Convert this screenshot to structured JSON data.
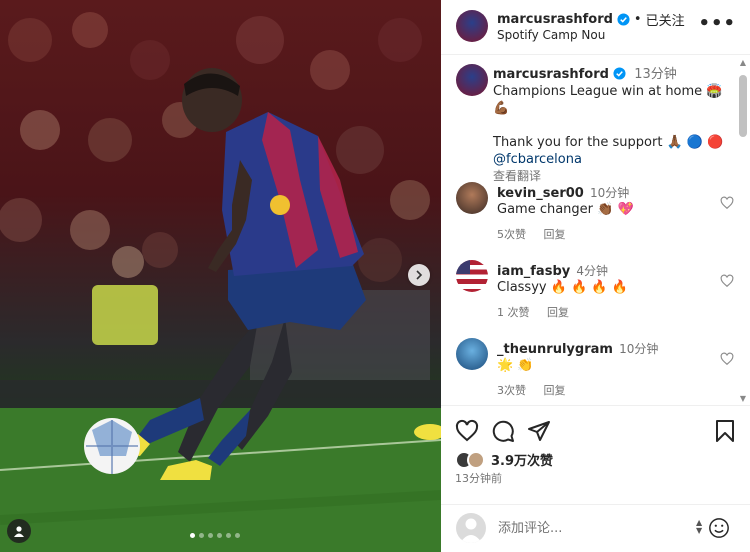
{
  "post": {
    "author": "marcusrashford",
    "follow_status": "已关注",
    "location": "Spotify Camp Nou",
    "more_icon": "more-options-icon",
    "caption_time": "13分钟",
    "caption_line1": "Champions League win at home 🏟️",
    "caption_line2": "💪🏾",
    "caption_line3": "Thank you for the support 🙏🏾 🔵 🔴",
    "caption_mention": "@fcbarcelona",
    "see_translation": "查看翻译",
    "photo_index": 1,
    "photo_count": 6
  },
  "comments": [
    {
      "user": "kevin_ser00",
      "time": "10分钟",
      "text": "Game changer 👏🏾 💖",
      "likes": "5次赞",
      "reply": "回复",
      "avatar_color": "#8a6a4a"
    },
    {
      "user": "iam_fasby",
      "time": "4分钟",
      "text": "Classyy 🔥 🔥 🔥 🔥",
      "likes": "1 次赞",
      "reply": "回复",
      "avatar_color": "#3b5998"
    },
    {
      "user": "_theunrulygram",
      "time": "10分钟",
      "text": "🌟 👏",
      "likes": "3次赞",
      "reply": "回复",
      "avatar_color": "#4a90c0"
    }
  ],
  "footer": {
    "likes": "3.9万次赞",
    "time_ago": "13分钟前",
    "comment_placeholder": "添加评论..."
  },
  "icons": [
    "heart-icon",
    "comment-icon",
    "share-icon",
    "bookmark-icon",
    "emoji-icon",
    "user-tag-icon",
    "chevron-right-icon"
  ]
}
